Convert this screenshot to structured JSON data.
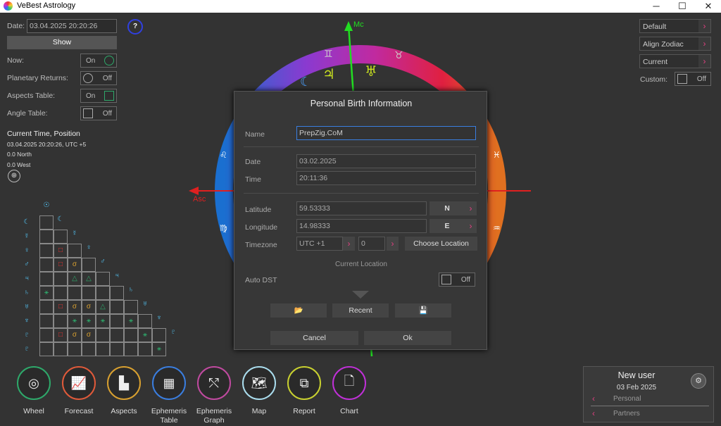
{
  "window": {
    "title": "VeBest Astrology"
  },
  "left_panel": {
    "date_label": "Date:",
    "date_value": "03.04.2025 20:20:26",
    "help": "?",
    "show": "Show",
    "now_label": "Now:",
    "now_state": "On",
    "returns_label": "Planetary Returns:",
    "returns_state": "Off",
    "aspects_label": "Aspects Table:",
    "aspects_state": "On",
    "angle_label": "Angle Table:",
    "angle_state": "Off",
    "current_title": "Current Time, Position",
    "current_line1": "03.04.2025 20:20:26, UTC +5",
    "current_line2": "0.0 North",
    "current_line3": "0.0 West"
  },
  "right_panel": {
    "default": "Default",
    "align": "Align Zodiac",
    "current": "Current",
    "custom_label": "Custom:",
    "custom_state": "Off"
  },
  "wheel": {
    "mc": "Mc",
    "asc": "Asc"
  },
  "dialog": {
    "title": "Personal Birth Information",
    "name_label": "Name",
    "name_value": "PrepZig.CoM",
    "date_label": "Date",
    "date_value": "03.02.2025",
    "time_label": "Time",
    "time_value": "20:11:36",
    "lat_label": "Latitude",
    "lat_value": "59.53333",
    "lat_dir": "N",
    "lon_label": "Longitude",
    "lon_value": "14.98333",
    "lon_dir": "E",
    "tz_label": "Timezone",
    "tz_value": "UTC +1",
    "tz_dst": "0",
    "choose_location": "Choose Location",
    "current_location": "Current Location",
    "autodst_label": "Auto DST",
    "autodst_state": "Off",
    "recent": "Recent",
    "cancel": "Cancel",
    "ok": "Ok"
  },
  "nav": [
    {
      "label": "Wheel",
      "color": "#2ea86a"
    },
    {
      "label": "Forecast",
      "color": "#e05a3a"
    },
    {
      "label": "Aspects",
      "color": "#d8a030"
    },
    {
      "label": "Ephemeris\nTable",
      "color": "#3a7ee0"
    },
    {
      "label": "Ephemeris\nGraph",
      "color": "#c04aa0"
    },
    {
      "label": "Map",
      "color": "#aaddee"
    },
    {
      "label": "Report",
      "color": "#c8d030"
    },
    {
      "label": "Chart",
      "color": "#c030d8"
    }
  ],
  "user": {
    "name": "New user",
    "date": "03 Feb 2025",
    "personal": "Personal",
    "partners": "Partners"
  }
}
